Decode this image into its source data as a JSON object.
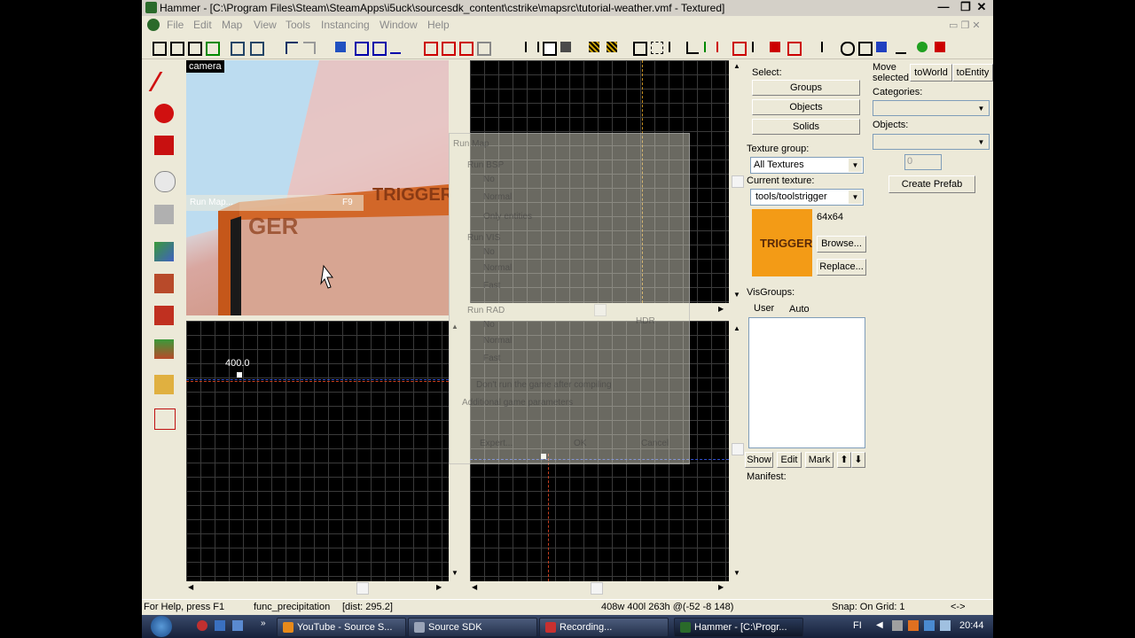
{
  "window": {
    "title": "Hammer - [C:\\Program Files\\Steam\\SteamApps\\i5uck\\sourcesdk_content\\cstrike\\mapsrc\\tutorial-weather.vmf - Textured]",
    "min_label": "—",
    "max_label": "❐",
    "close_label": "✕"
  },
  "menu": [
    "File",
    "Edit",
    "Map",
    "View",
    "Tools",
    "Instancing",
    "Window",
    "Help"
  ],
  "viewports": {
    "camera_label": "camera",
    "coord_readout": "400.0"
  },
  "run_map_menu": {
    "label": "Run Map...",
    "shortcut": "F9"
  },
  "run_map_dialog": {
    "title": "Run Map",
    "run_bsp": "Run BSP",
    "bsp_options": [
      "No",
      "Normal",
      "Only entities"
    ],
    "run_vis": "Run VIS",
    "vis_options": [
      "No",
      "Normal",
      "Fast"
    ],
    "run_rad": "Run RAD",
    "rad_options": [
      "No",
      "Normal",
      "Fast"
    ],
    "hdr": "HDR",
    "dont_run_game": "Don't run the game after compiling",
    "additional_params": "Additional game parameters",
    "expert": "Expert...",
    "ok": "OK",
    "cancel": "Cancel"
  },
  "side_panel": {
    "select_label": "Select:",
    "groups_btn": "Groups",
    "objects_btn": "Objects",
    "solids_btn": "Solids",
    "texture_group_label": "Texture group:",
    "texture_group_value": "All Textures",
    "current_texture_label": "Current texture:",
    "current_texture_value": "tools/toolstrigger",
    "texture_preview_text": "TRIGGER",
    "texture_size": "64x64",
    "browse_btn": "Browse...",
    "replace_btn": "Replace...",
    "visgroups_label": "VisGroups:",
    "tab_user": "User",
    "tab_auto": "Auto",
    "show_btn": "Show",
    "edit_btn": "Edit",
    "mark_btn": "Mark",
    "up_arrow": "⬆",
    "down_arrow": "⬇",
    "manifest_label": "Manifest:"
  },
  "prefab_panel": {
    "move_selected": "Move selected:",
    "to_world": "toWorld",
    "to_entity": "toEntity",
    "categories_label": "Categories:",
    "objects_label": "Objects:",
    "spinner_value": "0",
    "create_prefab": "Create Prefab"
  },
  "status": {
    "help": "For Help, press F1",
    "entity": "func_precipitation",
    "dist": "[dist: 295.2]",
    "dims": "408w 400l 263h @(-52 -8 148)",
    "snap": "Snap: On Grid: 1",
    "arrows": "<->"
  },
  "taskbar": {
    "tasks": [
      {
        "label": "YouTube - Source S...",
        "color": "#e88a1a"
      },
      {
        "label": "Source SDK",
        "color": "#9aa4b8"
      },
      {
        "label": "Recording...",
        "color": "#c83030"
      },
      {
        "label": "Hammer - [C:\\Progr...",
        "color": "#2a6a2a"
      }
    ],
    "lang": "FI",
    "clock": "20:44"
  },
  "colors": {
    "accent_trigger": "#f0a020",
    "texture_bg": "#f39b16",
    "grid_bg": "#000000"
  }
}
